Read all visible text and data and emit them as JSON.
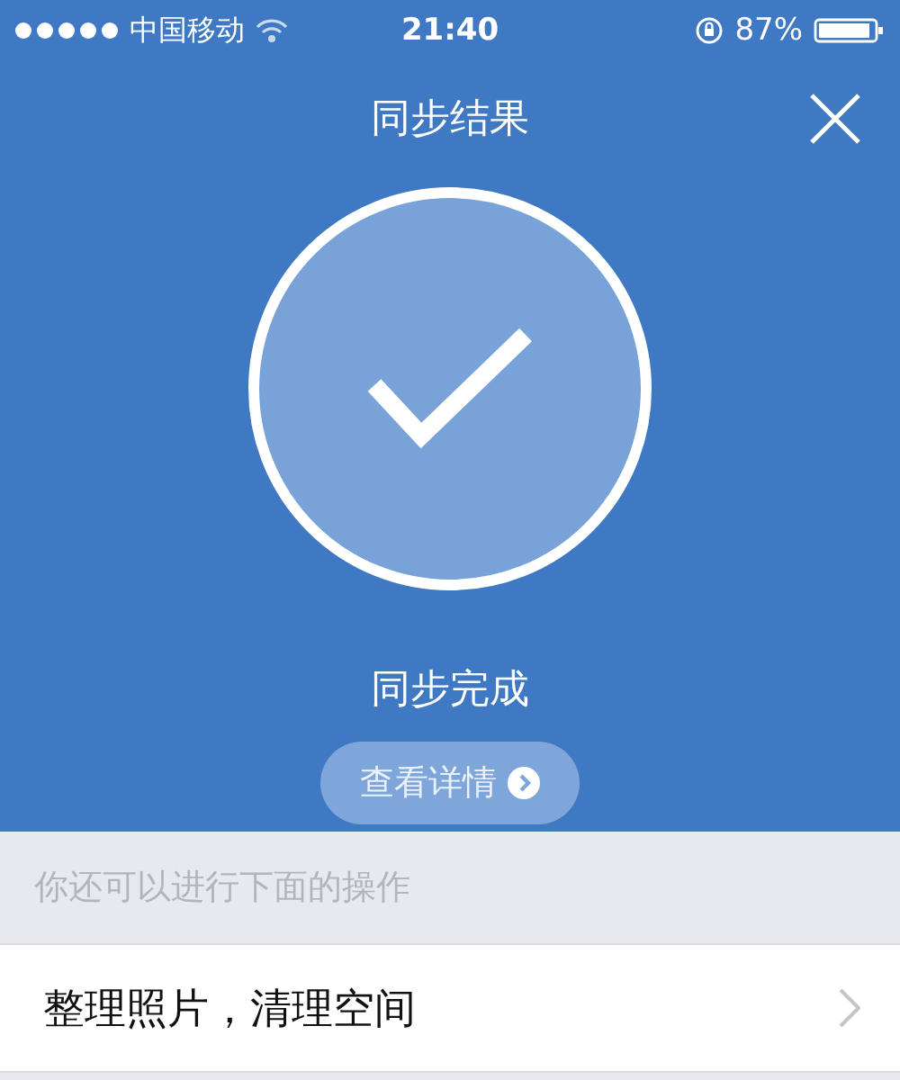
{
  "status_bar": {
    "carrier": "中国移动",
    "time": "21:40",
    "battery": "87%"
  },
  "header": {
    "title": "同步结果"
  },
  "result": {
    "status": "同步完成",
    "details_button": "查看详情"
  },
  "section": {
    "hint": "你还可以进行下面的操作"
  },
  "actions": [
    {
      "label": "整理照片，清理空间"
    }
  ]
}
